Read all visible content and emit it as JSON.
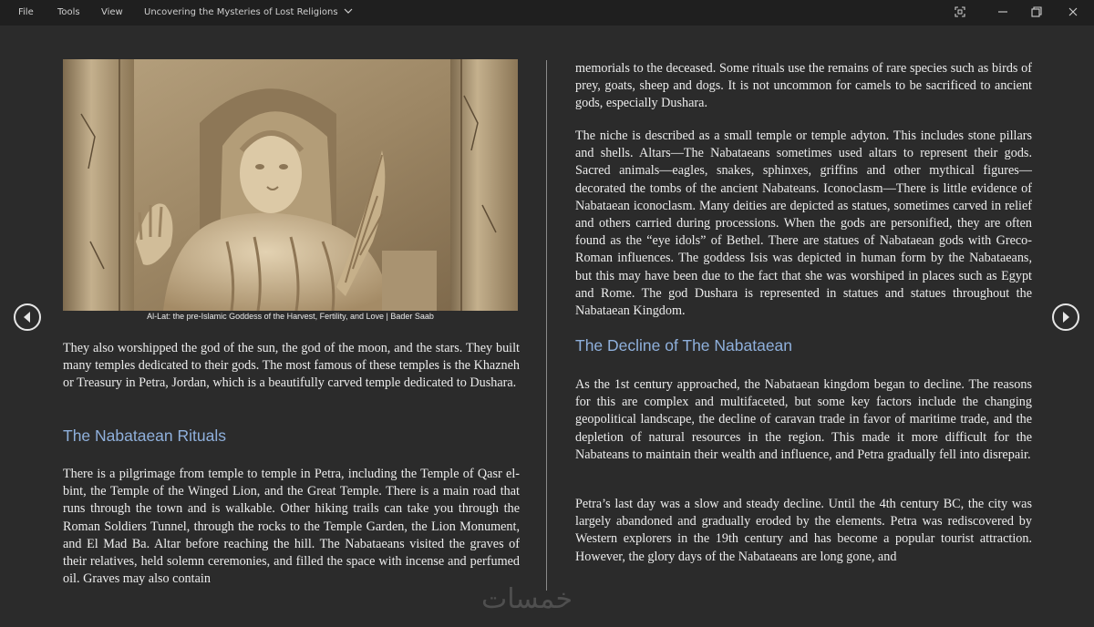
{
  "menu": {
    "file": "File",
    "tools": "Tools",
    "view": "View",
    "document_title": "Uncovering the Mysteries of Lost Religions",
    "title_dropdown_icon": "chevron-down-icon"
  },
  "window_controls": [
    "fullscreen-icon",
    "minimize-icon",
    "restore-icon",
    "close-icon"
  ],
  "navigation": {
    "previous_icon": "arrow-left-icon",
    "next_icon": "arrow-right-icon"
  },
  "figure": {
    "caption": "Al-Lat: the pre-Islamic Goddess of the Harvest, Fertility, and Love | Bader Saab"
  },
  "left_page": {
    "para1": "They also worshipped the god of the sun, the god of the moon, and the stars. They built many temples dedicated to their gods. The most famous of these temples is the Khazneh or Treasury in Petra, Jordan, which is a beautifully carved temple dedicated to Dushara.",
    "heading": "The Nabataean Rituals",
    "para2": "There is a pilgrimage from temple to temple in Petra, including the Temple of Qasr el-bint, the Temple of the Winged Lion, and the Great Temple. There is a main road that runs through the town and is walkable. Other hiking trails can take you through the Roman Soldiers Tunnel, through the rocks to the Temple Garden, the Lion Monument, and El Mad Ba. Altar before reaching the hill. The Nabataeans visited the graves of their relatives, held solemn ceremonies, and filled the space with incense and perfumed oil. Graves may also contain"
  },
  "right_page": {
    "para1": "memorials to the deceased. Some rituals use the remains of rare species such as birds of prey, goats, sheep and dogs. It is not uncommon for camels to be sacrificed to ancient gods, especially Dushara.",
    "para2": "The niche is described as a small temple or temple adyton. This includes stone pillars and shells. Altars—The Nabataeans sometimes used altars to represent their gods. Sacred animals—eagles, snakes, sphinxes, griffins and other mythical figures—decorated the tombs of the ancient Nabateans. Iconoclasm—There is little evidence of Nabataean iconoclasm. Many deities are depicted as statues, sometimes carved in relief and others carried during processions. When the gods are personified, they are often found as the “eye idols” of Bethel. There are statues of Nabataean gods with Greco-Roman influences. The goddess Isis was depicted in human form by the Nabataeans, but this may have been due to the fact that she was worshiped in places such as Egypt and Rome. The god Dushara is represented in statues and statues throughout the Nabataean Kingdom.",
    "heading": "The Decline of The Nabataean",
    "para3": "As the 1st century approached, the Nabataean kingdom began to decline. The reasons for this are complex and multifaceted, but some key factors include the changing geopolitical landscape, the decline of caravan trade in favor of maritime trade, and the depletion of natural resources in the region. This made it more difficult for the Nabateans to maintain their wealth and influence, and Petra gradually fell into disrepair.",
    "para4": "Petra’s last day was a slow and steady decline. Until the 4th century BC, the city was largely abandoned and gradually eroded by the elements. Petra was rediscovered by Western explorers in the 19th century and has become a popular tourist attraction. However, the glory days of the Nabataeans are long gone, and"
  },
  "watermark": {
    "text": "خمسات"
  }
}
